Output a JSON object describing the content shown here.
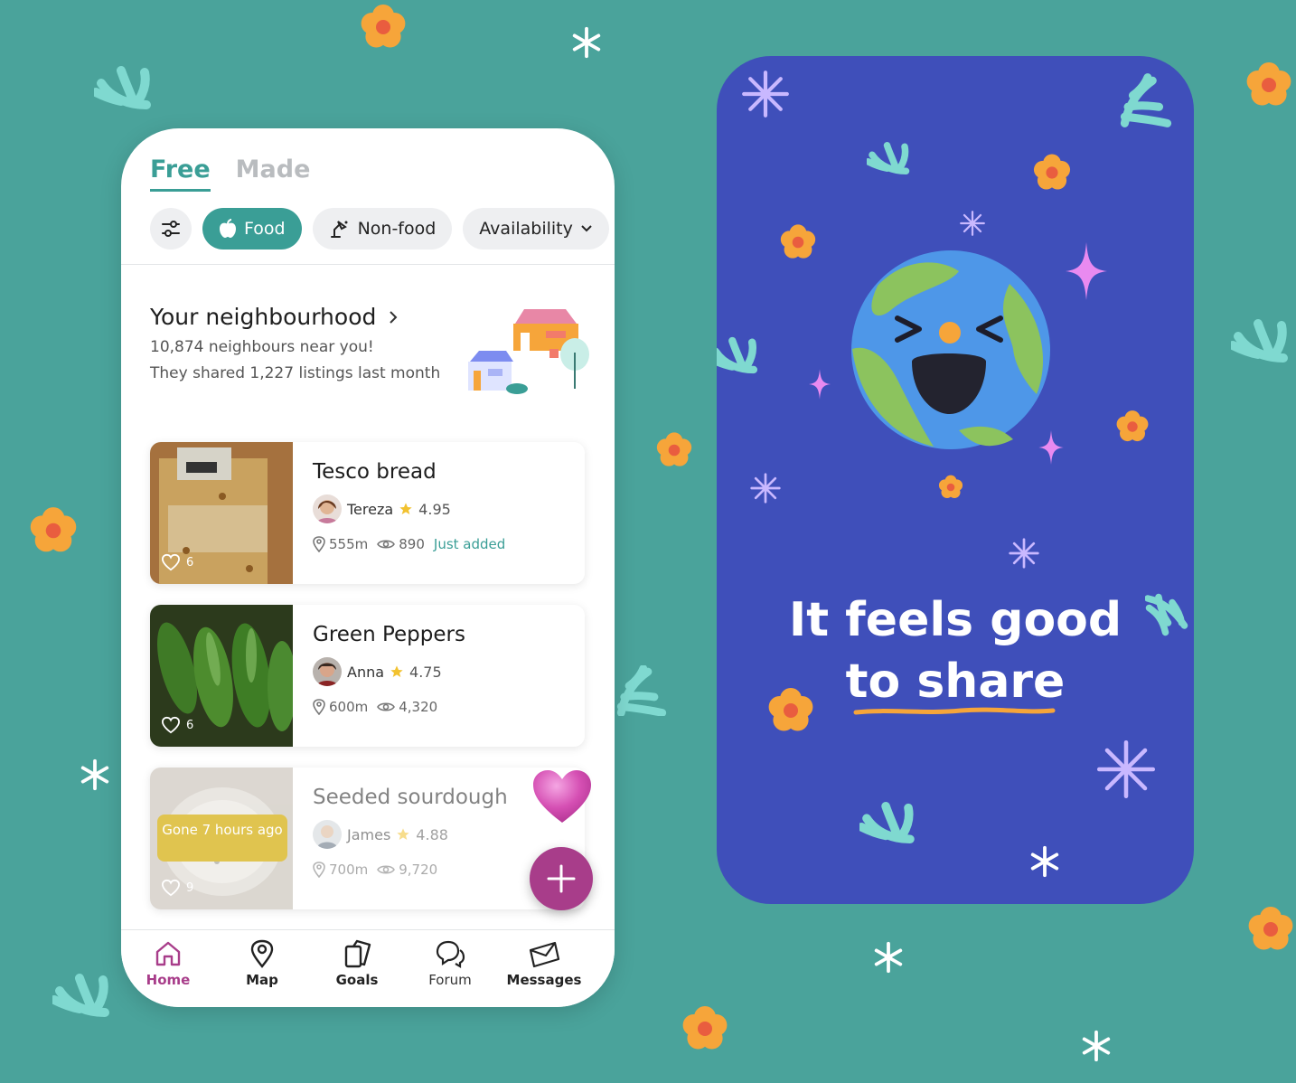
{
  "tabs": {
    "free": "Free",
    "made": "Made"
  },
  "chips": {
    "food": "Food",
    "nonfood": "Non-food",
    "availability": "Availability"
  },
  "neighbourhood": {
    "title": "Your neighbourhood",
    "line1": "10,874 neighbours near you!",
    "line2": "They shared 1,227 listings last month"
  },
  "listings": [
    {
      "title": "Tesco bread",
      "user": "Tereza",
      "rating": "4.95",
      "distance": "555m",
      "views": "890",
      "status": "Just added",
      "likes": "6"
    },
    {
      "title": "Green Peppers",
      "user": "Anna",
      "rating": "4.75",
      "distance": "600m",
      "views": "4,320",
      "likes": "6"
    },
    {
      "title": "Seeded sourdough",
      "user": "James",
      "rating": "4.88",
      "distance": "700m",
      "views": "9,720",
      "likes": "9",
      "badge": "Gone 7 hours ago"
    }
  ],
  "nav": {
    "home": "Home",
    "map": "Map",
    "goals": "Goals",
    "forum": "Forum",
    "messages": "Messages"
  },
  "promo": {
    "line1": "It feels good",
    "line2": "to share"
  },
  "colors": {
    "background": "#4aa39b",
    "accent": "#3a9e96",
    "primary": "#a83d8a",
    "promo_bg": "#3f4fba",
    "flower": "#f6a53a"
  }
}
